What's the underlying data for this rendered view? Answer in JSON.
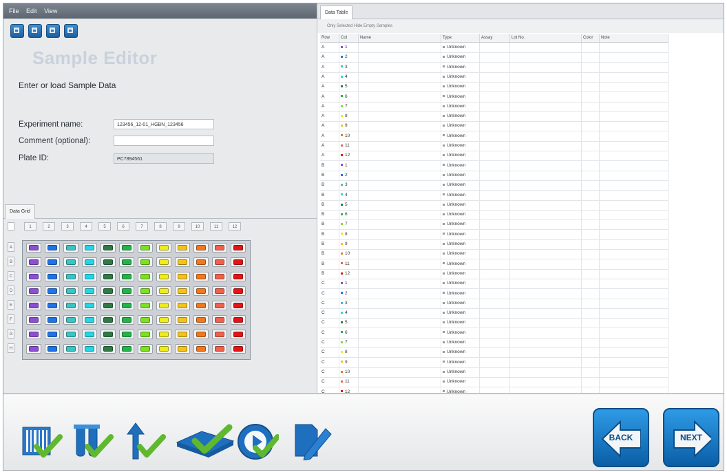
{
  "menu": [
    "File",
    "Edit",
    "View"
  ],
  "toolbar_icons": [
    "new-icon",
    "open-icon",
    "save-icon",
    "print-icon"
  ],
  "editor": {
    "title": "Sample Editor",
    "subtitle": "Enter or load Sample Data",
    "experiment_label": "Experiment name:",
    "experiment_value": "123456_12-01_HGBN_123456",
    "comment_label": "Comment (optional):",
    "comment_value": "",
    "plate_label": "Plate ID:",
    "plate_value": "PC7894561"
  },
  "data_grid": {
    "tab": "Data Grid",
    "columns": [
      "1",
      "2",
      "3",
      "4",
      "5",
      "6",
      "7",
      "8",
      "9",
      "10",
      "11",
      "12"
    ],
    "rows": [
      "A",
      "B",
      "C",
      "D",
      "E",
      "F",
      "G",
      "H"
    ],
    "column_colors": [
      "#8c4fd3",
      "#1f73e6",
      "#3cc3c3",
      "#22d6e6",
      "#2f7a44",
      "#24b34a",
      "#7ce11e",
      "#f0ec1c",
      "#f4c21a",
      "#f0781e",
      "#f0604a",
      "#e41414"
    ]
  },
  "data_table": {
    "tab": "Data Table",
    "filters": "Only Selected   Hide Empty Samples",
    "headers": [
      "Row",
      "Col",
      "Name",
      "Type",
      "Assay",
      "Lot No.",
      "Color",
      "Note"
    ],
    "type_value": "Unknown",
    "rows": [
      [
        "A",
        "1"
      ],
      [
        "A",
        "2"
      ],
      [
        "A",
        "3"
      ],
      [
        "A",
        "4"
      ],
      [
        "A",
        "5"
      ],
      [
        "A",
        "6"
      ],
      [
        "A",
        "7"
      ],
      [
        "A",
        "8"
      ],
      [
        "A",
        "9"
      ],
      [
        "A",
        "10"
      ],
      [
        "A",
        "11"
      ],
      [
        "A",
        "12"
      ],
      [
        "B",
        "1"
      ],
      [
        "B",
        "2"
      ],
      [
        "B",
        "3"
      ],
      [
        "B",
        "4"
      ],
      [
        "B",
        "5"
      ],
      [
        "B",
        "6"
      ],
      [
        "B",
        "7"
      ],
      [
        "B",
        "8"
      ],
      [
        "B",
        "9"
      ],
      [
        "B",
        "10"
      ],
      [
        "B",
        "11"
      ],
      [
        "B",
        "12"
      ],
      [
        "C",
        "1"
      ],
      [
        "C",
        "2"
      ],
      [
        "C",
        "3"
      ],
      [
        "C",
        "4"
      ],
      [
        "C",
        "5"
      ],
      [
        "C",
        "6"
      ],
      [
        "C",
        "7"
      ],
      [
        "C",
        "8"
      ],
      [
        "C",
        "9"
      ],
      [
        "C",
        "10"
      ],
      [
        "C",
        "11"
      ],
      [
        "C",
        "12"
      ]
    ]
  },
  "workflow": {
    "steps": [
      "barcode-check-icon",
      "tubes-check-icon",
      "transfer-check-icon",
      "plate-check-icon",
      "run-check-icon",
      "edit-notes-icon"
    ],
    "back_label": "BACK",
    "next_label": "NEXT"
  }
}
